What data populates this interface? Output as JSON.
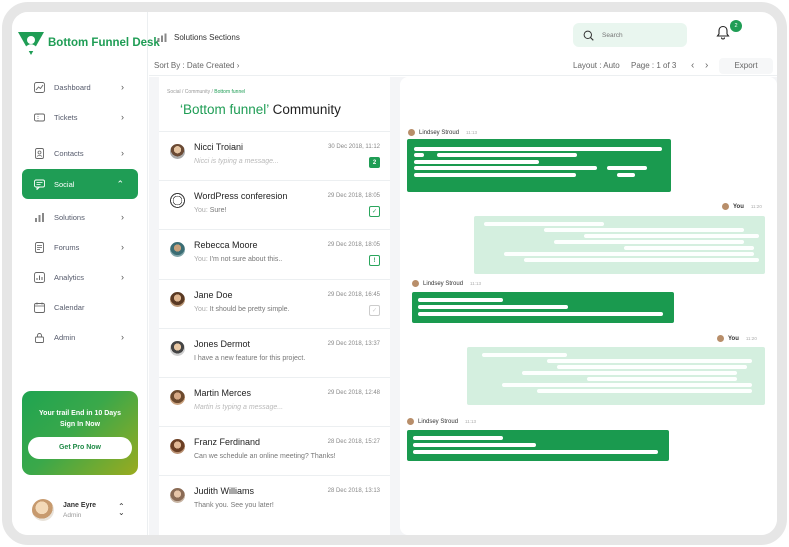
{
  "app": {
    "name": "Bottom Funnel Desk"
  },
  "sidebar": {
    "items": [
      {
        "label": "Dashboard",
        "icon": "chart-icon",
        "chevron": "›"
      },
      {
        "label": "Tickets",
        "icon": "ticket-icon",
        "chevron": "›"
      },
      {
        "label": "Contacts",
        "icon": "contacts-icon",
        "chevron": "›"
      },
      {
        "label": "Social",
        "icon": "chat-icon",
        "chevron": "⌃"
      },
      {
        "label": "Solutions",
        "icon": "bars-icon",
        "chevron": "›"
      },
      {
        "label": "Forums",
        "icon": "forum-icon",
        "chevron": "›"
      },
      {
        "label": "Analytics",
        "icon": "analytics-icon",
        "chevron": "›"
      },
      {
        "label": "Calendar",
        "icon": "calendar-icon"
      },
      {
        "label": "Admin",
        "icon": "lock-icon",
        "chevron": "›"
      }
    ],
    "active_index": 3,
    "promo": {
      "line1": "Your trail End in 10 Days",
      "line2": "Sign In Now",
      "button": "Get Pro Now"
    },
    "user": {
      "name": "Jane Eyre",
      "role": "Admin"
    }
  },
  "topbar": {
    "title": "Solutions Sections",
    "search_placeholder": "Search",
    "notifications": "2"
  },
  "subbar": {
    "sort": "Sort By : Date Created",
    "sort_chevron": "›",
    "layout": "Layout : Auto",
    "page": "Page : 1 of 3",
    "prev": "‹",
    "next": "›",
    "export": "Export"
  },
  "conversations": {
    "breadcrumb": {
      "a": "Social",
      "sep": " / ",
      "b": "Community",
      "c": "Bottom funnel"
    },
    "heading_brand": "‘Bottom funnel’",
    "heading_rest": " Community",
    "rows": [
      {
        "name": "Nicci Troiani",
        "date": "30 Dec 2018, 11:12",
        "prefix": "",
        "message": "Nicci is typing a message...",
        "typing": true,
        "status": "badge",
        "status_text": "2"
      },
      {
        "name": "WordPress conferesion",
        "date": "29 Dec 2018, 18:05",
        "prefix": "You: ",
        "message": "Sure!",
        "typing": false,
        "status": "check",
        "status_text": "✓"
      },
      {
        "name": "Rebecca Moore",
        "date": "29 Dec 2018, 18:05",
        "prefix": "You: ",
        "message": "I'm not sure about this..",
        "typing": false,
        "status": "alert",
        "status_text": "!"
      },
      {
        "name": "Jane Doe",
        "date": "29 Dec 2018, 16:45",
        "prefix": "You: ",
        "message": "It should be pretty simple.",
        "typing": false,
        "status": "check-grey",
        "status_text": "✓"
      },
      {
        "name": "Jones Dermot",
        "date": "29 Dec 2018, 13:37",
        "prefix": "",
        "message": "I have a new feature for this project.",
        "typing": false,
        "status": "",
        "status_text": ""
      },
      {
        "name": "Martin Merces",
        "date": "29 Dec 2018, 12:48",
        "prefix": "",
        "message": "Martin is typing a message...",
        "typing": true,
        "status": "",
        "status_text": ""
      },
      {
        "name": "Franz Ferdinand",
        "date": "28 Dec 2018, 15:27",
        "prefix": "",
        "message": "Can we schedule an online meeting? Thanks!",
        "typing": false,
        "status": "",
        "status_text": ""
      },
      {
        "name": "Judith Williams",
        "date": "28 Dec 2018, 13:13",
        "prefix": "",
        "message": "Thank you. See you later!",
        "typing": false,
        "status": "",
        "status_text": ""
      }
    ]
  },
  "chat": {
    "messages": [
      {
        "sender": "Lindsey Stroud",
        "time": "11:13",
        "direction": "in"
      },
      {
        "sender": "You",
        "time": "11:20",
        "direction": "out"
      },
      {
        "sender": "Lindsey Stroud",
        "time": "11:13",
        "direction": "in"
      },
      {
        "sender": "You",
        "time": "11:20",
        "direction": "out"
      },
      {
        "sender": "Lindsey Stroud",
        "time": "11:13",
        "direction": "in"
      }
    ]
  },
  "colors": {
    "accent": "#1f9d55",
    "bubble_in": "#1a9a4f",
    "bubble_out": "#d4efdf",
    "search_bg": "#e9f6ef"
  }
}
